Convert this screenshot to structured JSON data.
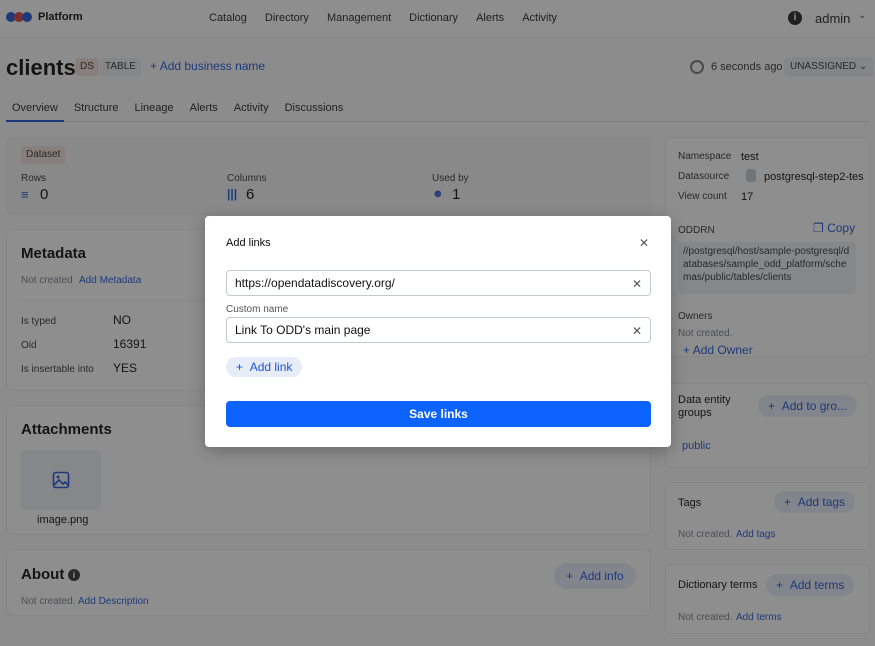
{
  "brand": {
    "name": "Platform",
    "dot_colors": [
      "#1f56d6",
      "#e03b3b",
      "#1f56d6"
    ]
  },
  "nav": {
    "items": [
      "Catalog",
      "Directory",
      "Management",
      "Dictionary",
      "Alerts",
      "Activity"
    ],
    "user": "admin"
  },
  "entity": {
    "name": "clients",
    "badge_ds": "DS",
    "badge_type": "TABLE",
    "add_business_name": "Add business name",
    "updated": "6 seconds ago",
    "owner_status": "UNASSIGNED"
  },
  "tabs": [
    "Overview",
    "Structure",
    "Lineage",
    "Alerts",
    "Activity",
    "Discussions"
  ],
  "stats": {
    "dataset_label": "Dataset",
    "rows_label": "Rows",
    "rows_value": "0",
    "columns_label": "Columns",
    "columns_value": "6",
    "usedby_label": "Used by",
    "usedby_value": "1"
  },
  "metadata": {
    "title": "Metadata",
    "not_created": "Not created",
    "add_link": "Add Metadata",
    "rows": [
      {
        "key": "Is typed",
        "value": "NO"
      },
      {
        "key": "Oid",
        "value": "16391"
      },
      {
        "key": "Is insertable into",
        "value": "YES"
      }
    ]
  },
  "attachments": {
    "title": "Attachments",
    "file_name": "image.png"
  },
  "about": {
    "title": "About",
    "not_created": "Not created.",
    "add_link": "Add Description",
    "add_button": "Add info"
  },
  "side": {
    "namespace_label": "Namespace",
    "namespace_value": "test",
    "datasource_label": "Datasource",
    "datasource_value": "postgresql-step2-tes",
    "viewcount_label": "View count",
    "viewcount_value": "17",
    "oddrn_label": "ODDRN",
    "copy_label": "Copy",
    "oddrn_value": "//postgresql/host/sample-postgresql/databases/sample_odd_platform/schemas/public/tables/clients",
    "owners_label": "Owners",
    "owners_not_created": "Not created.",
    "add_owner": "Add Owner",
    "groups_label": "Data entity groups",
    "add_group": "Add to gro...",
    "group_value": "public",
    "tags_label": "Tags",
    "add_tags_button": "Add tags",
    "tags_not_created": "Not created.",
    "tags_add_link": "Add tags",
    "terms_label": "Dictionary terms",
    "add_terms_button": "Add terms",
    "terms_not_created": "Not created.",
    "terms_add_link": "Add terms"
  },
  "modal": {
    "title": "Add links",
    "url_value": "https://opendatadiscovery.org/",
    "custom_name_label": "Custom name",
    "name_value": "Link To ODD's main page",
    "add_link": "Add link",
    "save": "Save links"
  }
}
